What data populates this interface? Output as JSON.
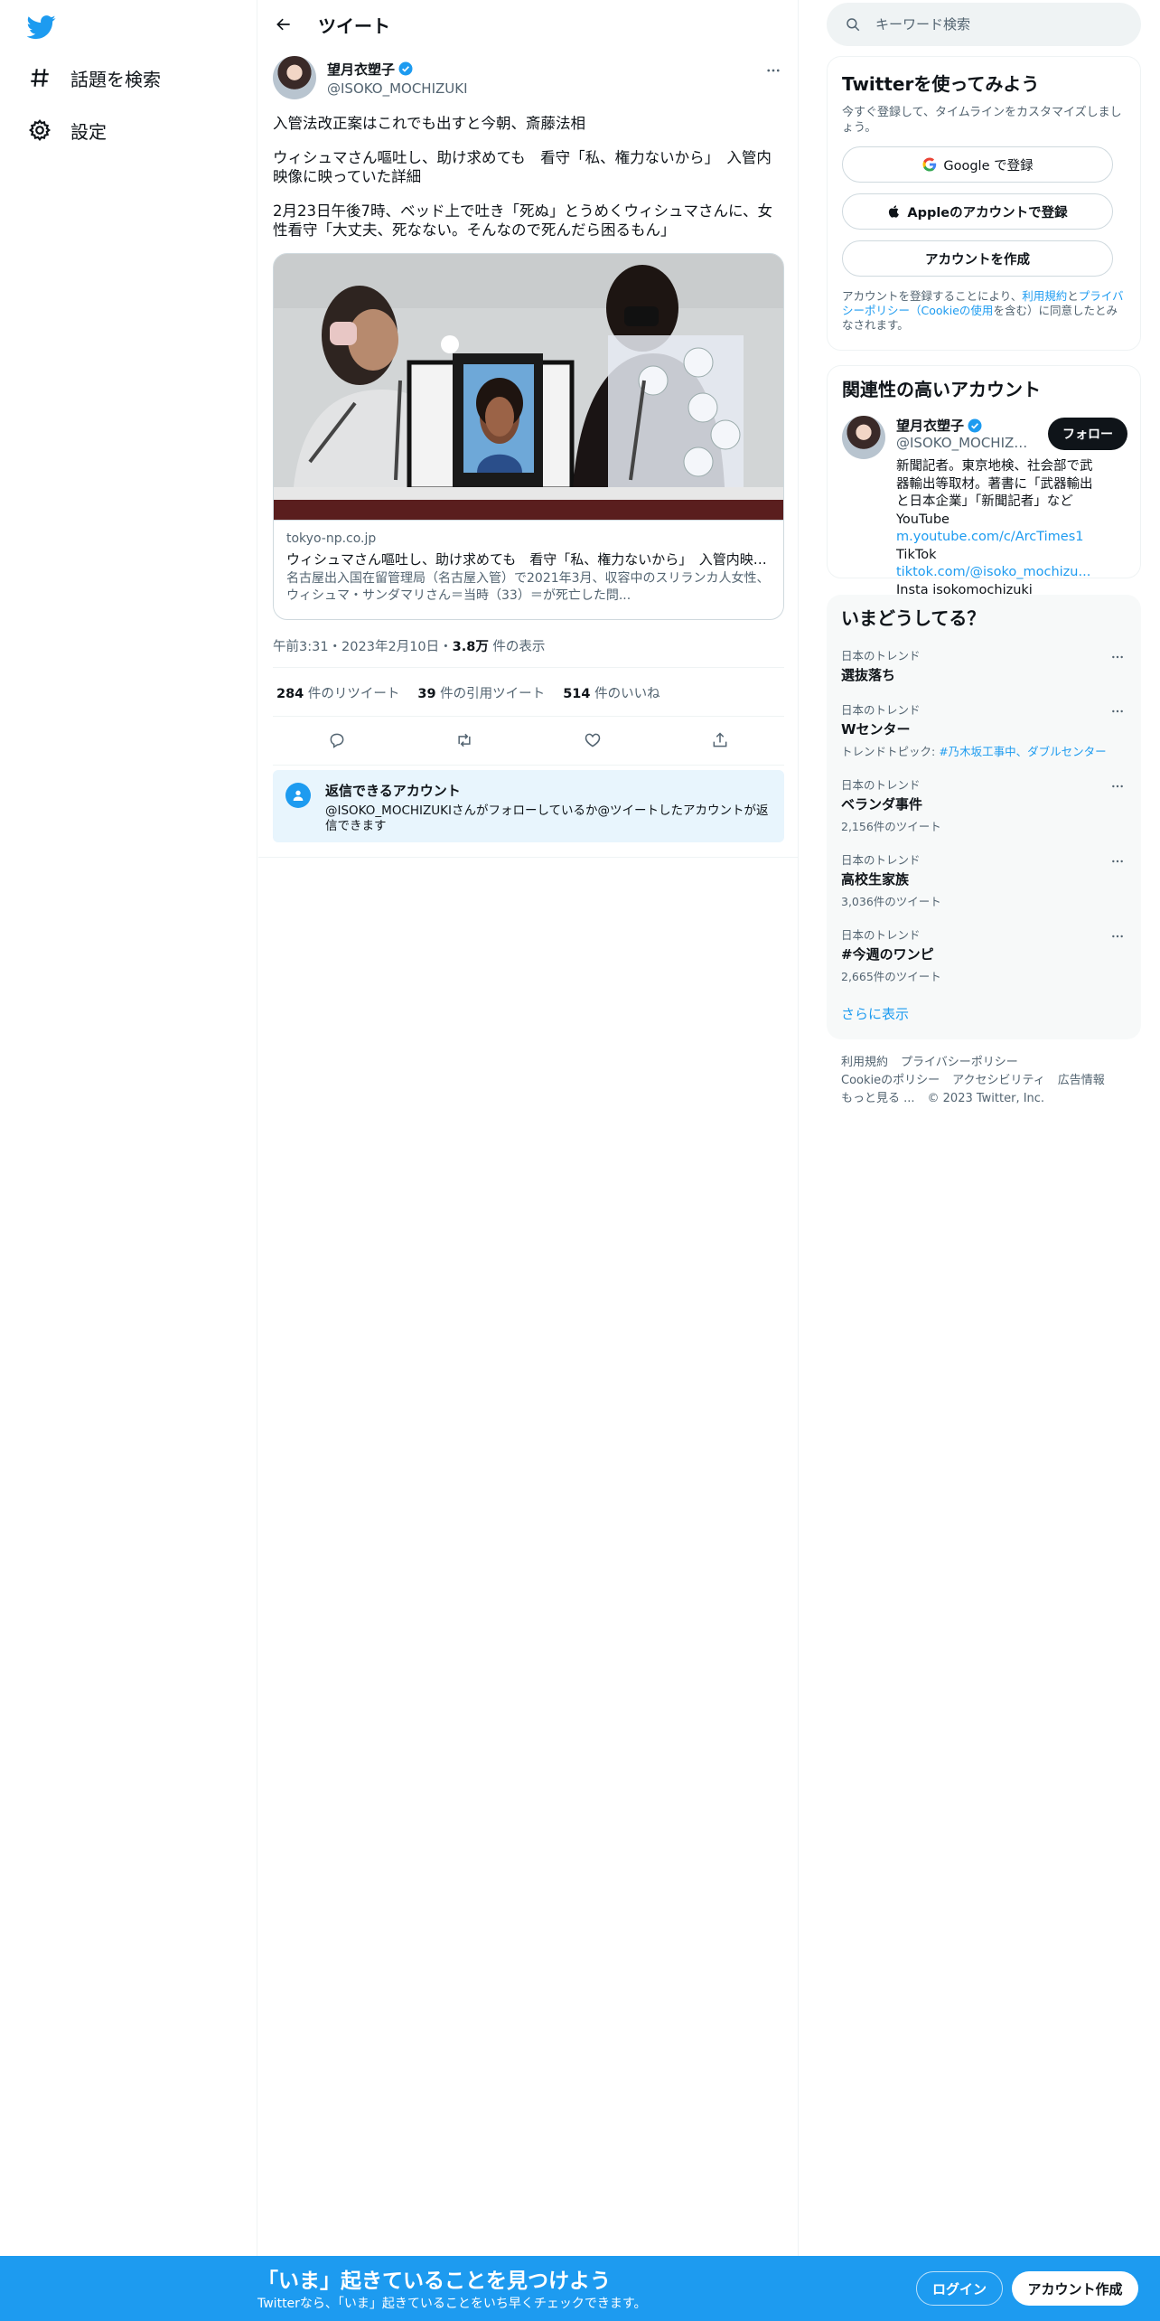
{
  "nav": {
    "explore_label": "話題を検索",
    "settings_label": "設定"
  },
  "header": {
    "title": "ツイート"
  },
  "tweet": {
    "author_name": "望月衣塑子",
    "author_handle": "@ISOKO_MOCHIZUKI",
    "paragraphs": [
      "入管法改正案はこれでも出すと今朝、斎藤法相",
      "ウィシュマさん嘔吐し、助け求めても　看守「私、権力ないから」　入管内映像に映っていた詳細",
      "2月23日午後7時、ベッド上で吐き「死ぬ」とうめくウィシュマさんに、女性看守「大丈夫、死なない。そんなので死んだら困るもん」"
    ],
    "card": {
      "domain": "tokyo-np.co.jp",
      "title": "ウィシュマさん嘔吐し、助け求めても　看守「私、権力ないから」　入管内映像に映っていた詳細",
      "description": "名古屋出入国在留管理局（名古屋入管）で2021年3月、収容中のスリランカ人女性、ウィシュマ・サンダマリさん＝当時（33）＝が死亡した問..."
    },
    "timestamp": "午前3:31・2023年2月10日・",
    "views_count": "3.8万",
    "views_label": " 件の表示",
    "retweets_count": "284",
    "retweets_label": " 件のリツイート",
    "quotes_count": "39",
    "quotes_label": " 件の引用ツイート",
    "likes_count": "514",
    "likes_label": " 件のいいね"
  },
  "reply_info": {
    "title": "返信できるアカウント",
    "description": "@ISOKO_MOCHIZUKIさんがフォローしているか@ツイートしたアカウントが返信できます"
  },
  "search": {
    "placeholder": "キーワード検索"
  },
  "signup_panel": {
    "title": "Twitterを使ってみよう",
    "subtitle": "今すぐ登録して、タイムラインをカスタマイズしましょう。",
    "google_button": "Google で登録",
    "apple_button": "Appleのアカウントで登録",
    "create_button": "アカウントを作成",
    "legal_prefix": "アカウントを登録することにより、",
    "legal_terms": "利用規約",
    "legal_and": "と",
    "legal_privacy": "プライバシーポリシー（Cookieの使用",
    "legal_suffix": "を含む）に同意したとみなされます。"
  },
  "related_panel": {
    "title": "関連性の高いアカウント",
    "name": "望月衣塑子",
    "handle": "@ISOKO_MOCHIZUKI",
    "follow_button": "フォロー",
    "bio_text": "新聞記者。東京地検、社会部で武器輸出等取材。著書に「武器輸出と日本企業」「新聞記者」など YouTube ",
    "bio_link1": "m.youtube.com/c/ArcTimes1",
    "bio_mid": " TikTok ",
    "bio_link2": "tiktok.com/@isoko_mochizu...",
    "bio_end": " Insta isokomochizuki"
  },
  "trends_panel": {
    "title": "いまどうしてる？",
    "trends": [
      {
        "context": "日本のトレンド",
        "name": "選抜落ち",
        "count": ""
      },
      {
        "context": "日本のトレンド",
        "name": "Wセンター",
        "topic_prefix": "トレンドトピック: ",
        "topic_links": "#乃木坂工事中、ダブルセンター"
      },
      {
        "context": "日本のトレンド",
        "name": "ベランダ事件",
        "count": "2,156件のツイート"
      },
      {
        "context": "日本のトレンド",
        "name": "高校生家族",
        "count": "3,036件のツイート"
      },
      {
        "context": "日本のトレンド",
        "name": "#今週のワンピ",
        "count": "2,665件のツイート"
      }
    ],
    "show_more": "さらに表示"
  },
  "footer": {
    "links": [
      "利用規約",
      "プライバシーポリシー",
      "Cookieのポリシー",
      "アクセシビリティ",
      "広告情報",
      "もっと見る ..."
    ],
    "copyright": "© 2023 Twitter, Inc."
  },
  "bottom_bar": {
    "title": "「いま」起きていることを見つけよう",
    "subtitle": "Twitterなら、「いま」起きていることをいち早くチェックできます。",
    "login_button": "ログイン",
    "signup_button": "アカウント作成"
  },
  "colors": {
    "brand_blue": "#1d9bf0",
    "text_primary": "#0f1419",
    "text_secondary": "#536471"
  }
}
